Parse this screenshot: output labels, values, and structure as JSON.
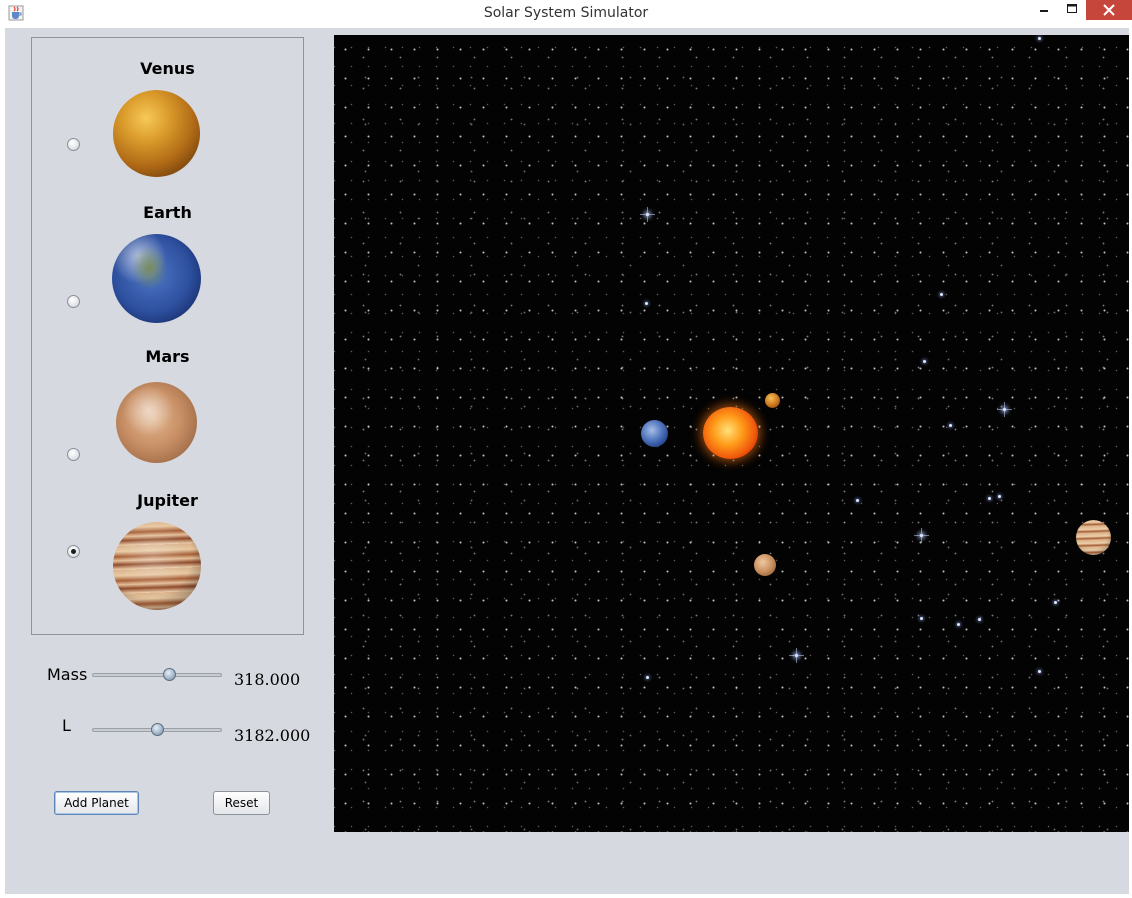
{
  "window": {
    "title": "Solar System Simulator",
    "icons": {
      "app": "java-cup-icon",
      "minimize": "minimize-icon",
      "maximize": "maximize-icon",
      "close": "close-icon"
    },
    "close_button_color": "#c7463b"
  },
  "planets": [
    {
      "name": "Venus",
      "selected": false,
      "icon": "venus-planet-image"
    },
    {
      "name": "Earth",
      "selected": false,
      "icon": "earth-planet-image"
    },
    {
      "name": "Mars",
      "selected": false,
      "icon": "mars-planet-image"
    },
    {
      "name": "Jupiter",
      "selected": true,
      "icon": "jupiter-planet-image"
    }
  ],
  "controls": {
    "mass": {
      "label": "Mass",
      "value": "318.000",
      "slider_fraction": 0.59
    },
    "l": {
      "label": "L",
      "value": "3182.000",
      "slider_fraction": 0.5
    }
  },
  "buttons": {
    "add_planet": "Add Planet",
    "reset": "Reset"
  },
  "simulation": {
    "background": "starfield",
    "bodies": [
      "sun",
      "earth",
      "venus",
      "mars",
      "jupiter"
    ]
  },
  "colors": {
    "window_background": "#d6d9e0",
    "canvas_background": "#030303",
    "sun": "#f05a0c"
  }
}
